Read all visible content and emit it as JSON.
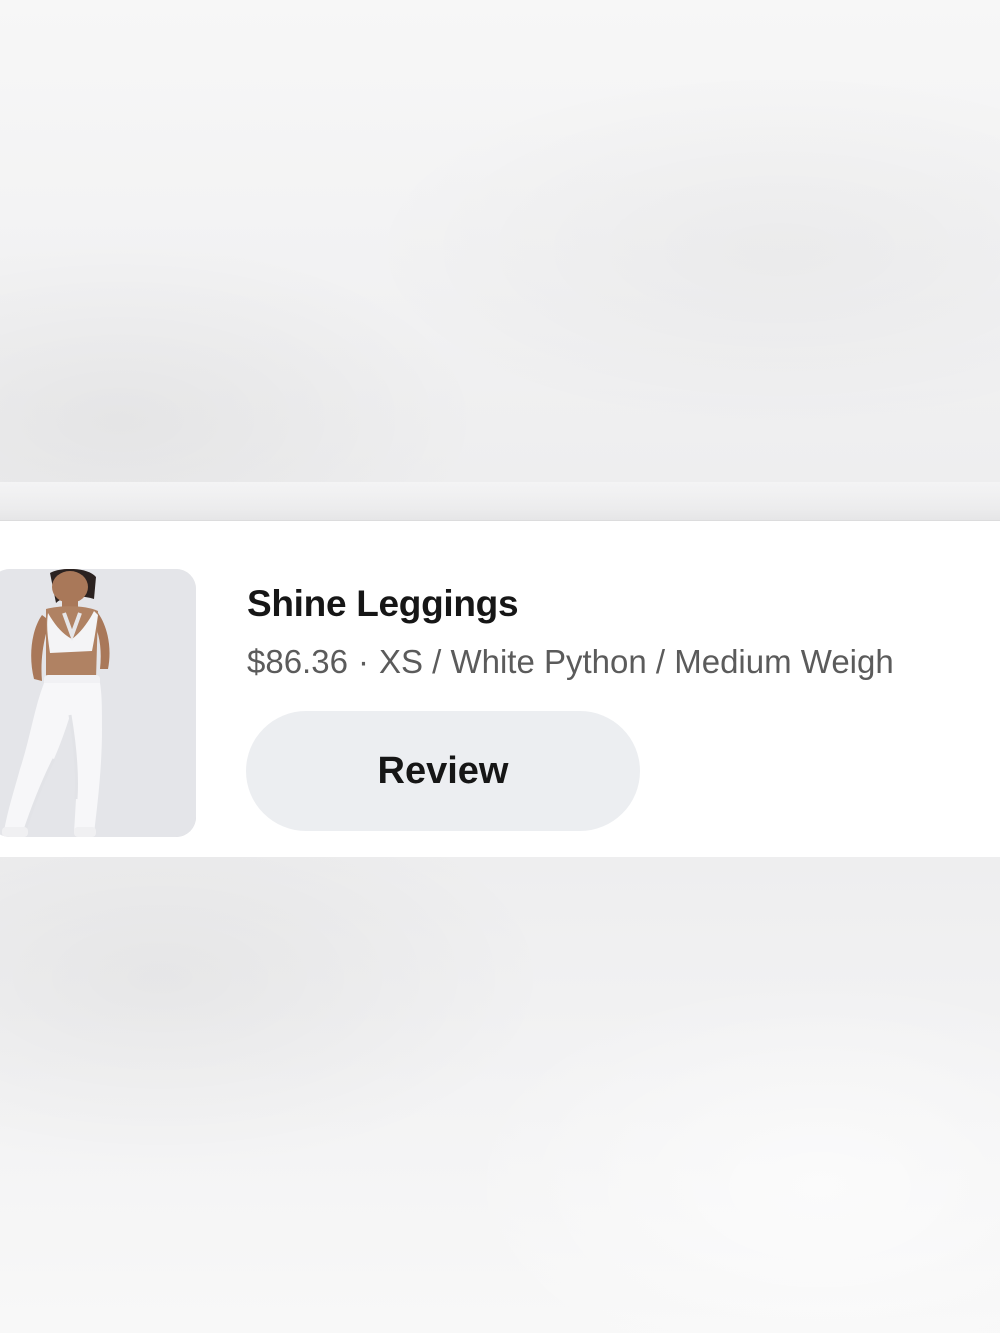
{
  "order_item": {
    "product_name": "Shine Leggings",
    "price": "$86.36",
    "separator": "·",
    "variant": "XS / White  Python / Medium Weigh",
    "review_label": "Review",
    "thumbnail_icon": "product-photo"
  }
}
